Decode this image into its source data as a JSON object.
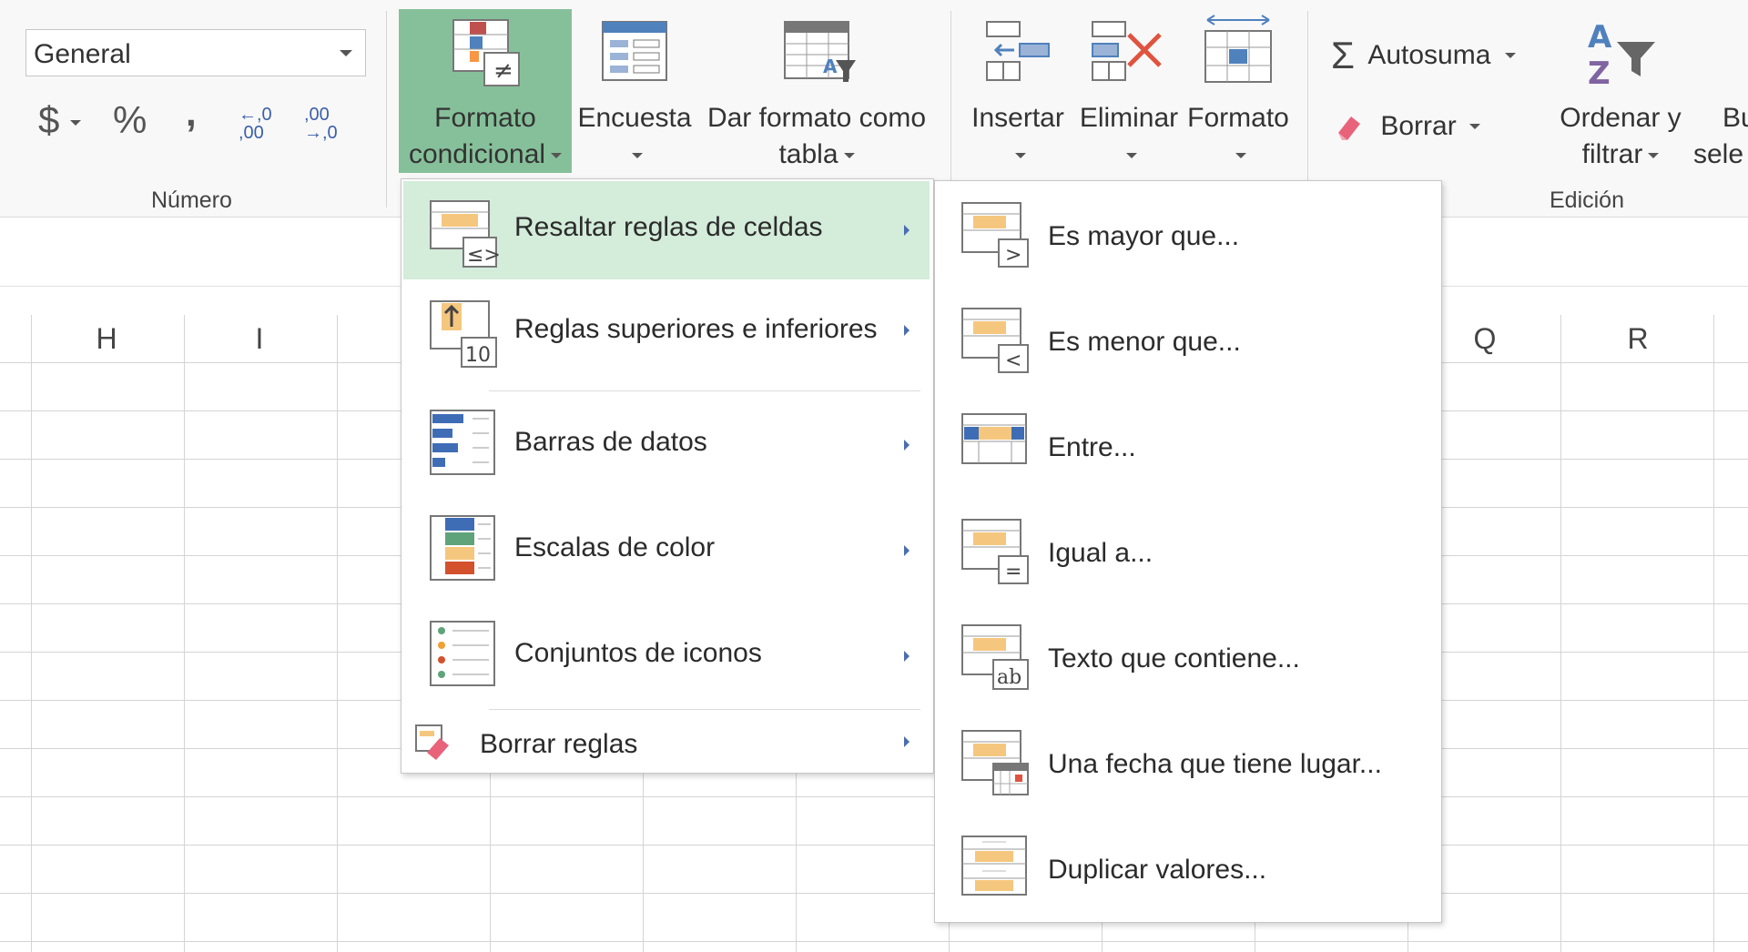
{
  "ribbon": {
    "number_group": {
      "format_value": "General",
      "currency_label": "$",
      "percent_label": "%",
      "comma_label": ",",
      "inc_decimal_label": "←,0 ,00",
      "dec_decimal_label": ",00 →,0",
      "group_label": "Número"
    },
    "styles_group": {
      "cond_format_line1": "Formato",
      "cond_format_line2": "condicional",
      "survey_label": "Encuesta",
      "table_format_line1": "Dar formato como",
      "table_format_line2": "tabla"
    },
    "cells_group": {
      "insert_label": "Insertar",
      "delete_label": "Eliminar",
      "format_label": "Formato"
    },
    "editing_group": {
      "autosum_label": "Autosuma",
      "clear_label": "Borrar",
      "sort_line1": "Ordenar y",
      "sort_line2": "filtrar",
      "find_line1": "Bu",
      "find_line2": "sele",
      "group_label": "Edición"
    }
  },
  "columns": [
    "H",
    "I",
    "Q",
    "R"
  ],
  "cond_menu": {
    "items": [
      {
        "label": "Resaltar reglas de celdas",
        "icon": "highlight-rules-icon",
        "active": true
      },
      {
        "label": "Reglas superiores e inferiores",
        "icon": "top-bottom-icon"
      },
      {
        "label": "Barras de datos",
        "icon": "data-bars-icon"
      },
      {
        "label": "Escalas de color",
        "icon": "color-scales-icon"
      },
      {
        "label": "Conjuntos de iconos",
        "icon": "icon-sets-icon"
      },
      {
        "label": "Borrar reglas",
        "icon": "clear-rules-icon"
      }
    ]
  },
  "submenu": {
    "items": [
      {
        "label": "Es mayor que...",
        "icon": "greater-than-icon"
      },
      {
        "label": "Es menor que...",
        "icon": "less-than-icon"
      },
      {
        "label": "Entre...",
        "icon": "between-icon"
      },
      {
        "label": "Igual a...",
        "icon": "equal-to-icon"
      },
      {
        "label": "Texto que contiene...",
        "icon": "text-contains-icon"
      },
      {
        "label": "Una fecha que tiene lugar...",
        "icon": "date-occurring-icon"
      },
      {
        "label": "Duplicar valores...",
        "icon": "duplicate-values-icon"
      }
    ]
  },
  "colors": {
    "highlight": "#86c09a",
    "menu_active": "#d4ecda",
    "arrow": "#4a6db0"
  }
}
